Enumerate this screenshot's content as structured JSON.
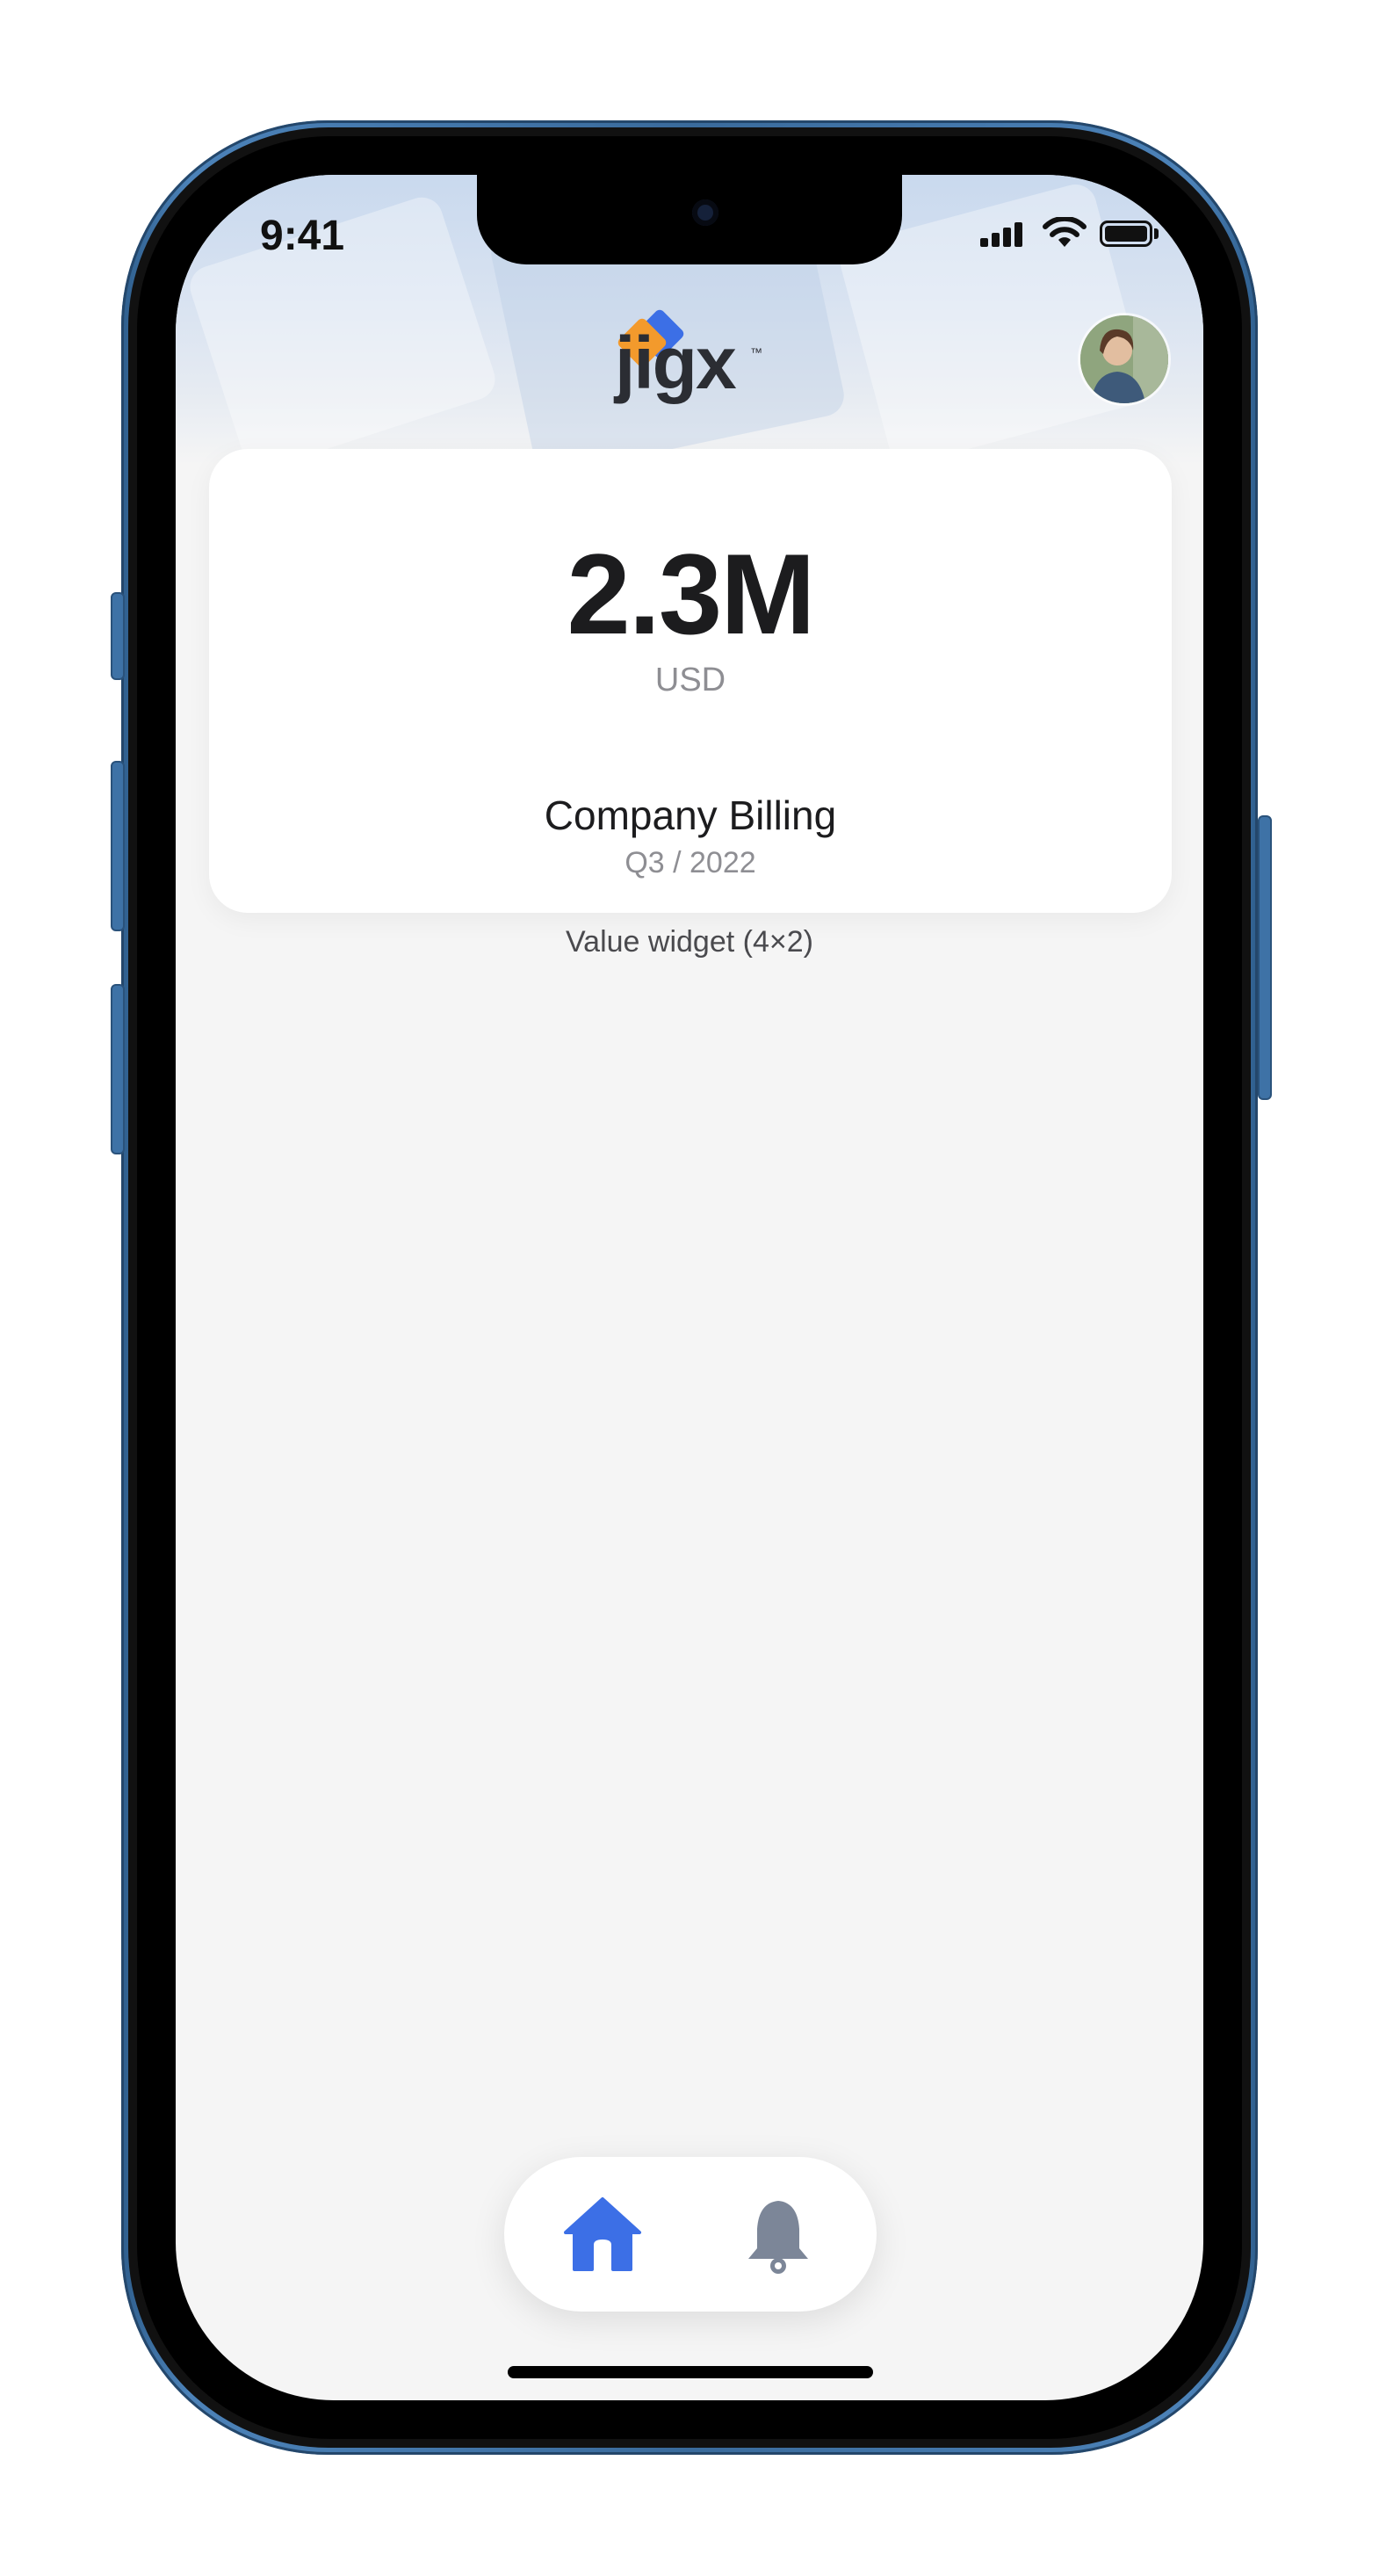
{
  "status_bar": {
    "time": "9:41"
  },
  "header": {
    "logo_text": "jigx",
    "logo_tm": "™",
    "avatar_icon": "user-avatar"
  },
  "value_widget": {
    "value": "2.3M",
    "unit": "USD",
    "title": "Company Billing",
    "subtitle": "Q3 / 2022",
    "caption": "Value widget (4×2)"
  },
  "tabbar": {
    "tabs": [
      {
        "icon": "home-icon",
        "active": true
      },
      {
        "icon": "bell-icon",
        "active": false
      }
    ]
  },
  "colors": {
    "accent": "#3c6fe6",
    "logo_orange": "#f39a2c",
    "inactive_icon": "#7c8698",
    "frame_blue": "#3a6b9c"
  }
}
